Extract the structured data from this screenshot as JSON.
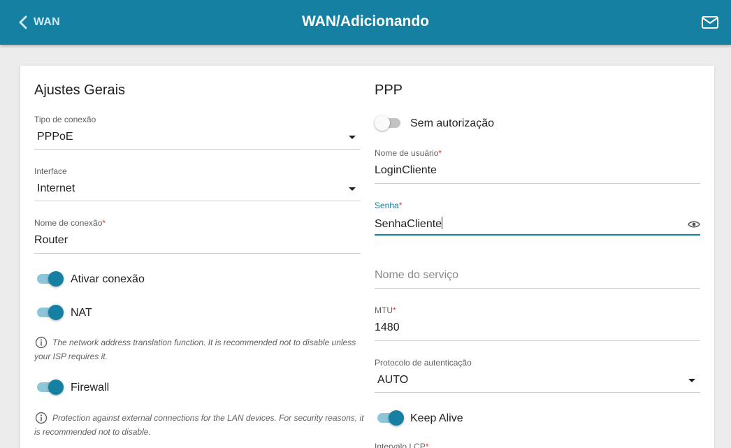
{
  "header": {
    "back_label": "WAN",
    "title": "WAN/Adicionando",
    "icons": {
      "back": "chevron-left-icon",
      "mail": "mail-icon"
    },
    "color": "#1580a2"
  },
  "general": {
    "heading": "Ajustes Gerais",
    "connection_type": {
      "label": "Tipo de conexão",
      "value": "PPPoE"
    },
    "interface": {
      "label": "Interface",
      "value": "Internet"
    },
    "connection_name": {
      "label": "Nome de conexão",
      "required": "*",
      "value": "Router"
    },
    "enable_connection": {
      "label": "Ativar conexão",
      "on": true
    },
    "nat": {
      "label": "NAT",
      "on": true,
      "note": [
        "The network address translation function. It is recommended not to disable unless",
        "your ISP requires it."
      ]
    },
    "firewall": {
      "label": "Firewall",
      "on": true,
      "note": [
        "Protection against external connections for the LAN devices. For security reasons, it",
        "is recommended not to disable."
      ]
    }
  },
  "ppp": {
    "heading": "PPP",
    "no_auth": {
      "label": "Sem autorização",
      "on": false
    },
    "username": {
      "label": "Nome de usuário",
      "required": "*",
      "value": "LoginCliente"
    },
    "password": {
      "label": "Senha",
      "required": "*",
      "value": "SenhaCliente"
    },
    "service_name": {
      "placeholder": "Nome do serviço"
    },
    "mtu": {
      "label": "MTU",
      "required": "*",
      "value": "1480"
    },
    "auth_protocol": {
      "label": "Protocolo de autenticação",
      "value": "AUTO"
    },
    "keep_alive": {
      "label": "Keep Alive",
      "on": true
    },
    "lcp_interval": {
      "label": "Intervalo LCP",
      "required": "*"
    }
  }
}
